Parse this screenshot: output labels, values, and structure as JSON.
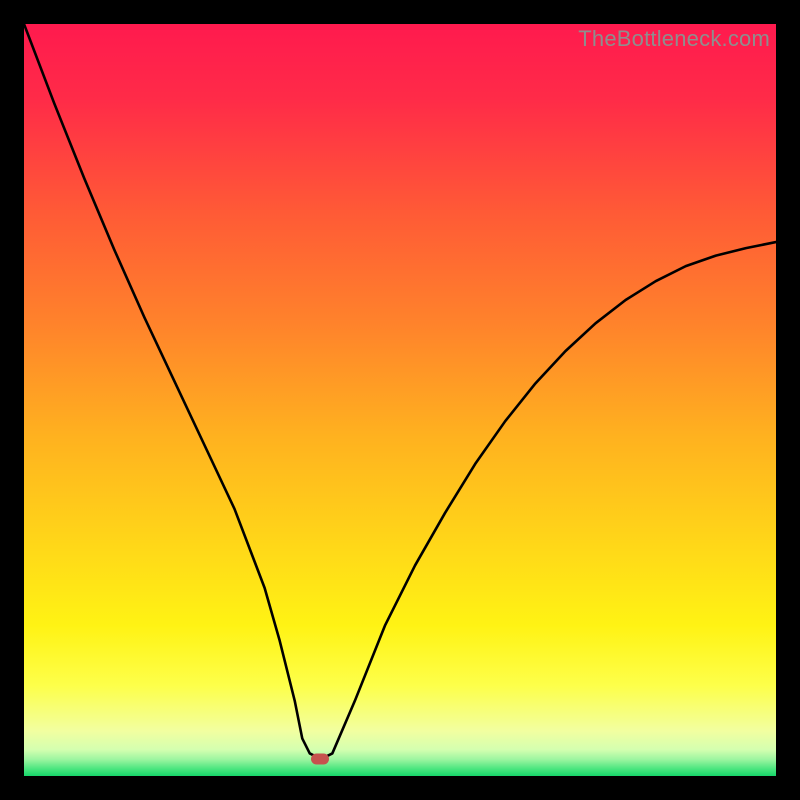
{
  "watermark": "TheBottleneck.com",
  "chart_data": {
    "type": "line",
    "title": "",
    "xlabel": "",
    "ylabel": "",
    "xlim": [
      0,
      100
    ],
    "ylim": [
      0,
      100
    ],
    "x": [
      0,
      4,
      8,
      12,
      16,
      20,
      24,
      28,
      32,
      34,
      36,
      37,
      38,
      39,
      40,
      41,
      44,
      48,
      52,
      56,
      60,
      64,
      68,
      72,
      76,
      80,
      84,
      88,
      92,
      96,
      100
    ],
    "y": [
      100,
      89.5,
      79.5,
      70,
      61,
      52.5,
      44,
      35.5,
      25,
      18,
      10,
      5,
      3,
      2.5,
      2.5,
      3,
      10,
      20,
      28,
      35,
      41.5,
      47.2,
      52.2,
      56.5,
      60.2,
      63.3,
      65.8,
      67.8,
      69.2,
      70.2,
      71
    ],
    "marker": {
      "x": 39.3,
      "y": 2.3
    },
    "gradient_stops": [
      {
        "offset": 0.0,
        "color": "#ff1a4e"
      },
      {
        "offset": 0.1,
        "color": "#ff2b48"
      },
      {
        "offset": 0.25,
        "color": "#ff5a36"
      },
      {
        "offset": 0.4,
        "color": "#ff832b"
      },
      {
        "offset": 0.55,
        "color": "#ffb21f"
      },
      {
        "offset": 0.7,
        "color": "#ffd918"
      },
      {
        "offset": 0.8,
        "color": "#fff314"
      },
      {
        "offset": 0.88,
        "color": "#fdff4a"
      },
      {
        "offset": 0.94,
        "color": "#f2ffa0"
      },
      {
        "offset": 0.965,
        "color": "#d4ffb0"
      },
      {
        "offset": 0.978,
        "color": "#9cf5a0"
      },
      {
        "offset": 0.99,
        "color": "#4ee680"
      },
      {
        "offset": 1.0,
        "color": "#16d66a"
      }
    ]
  }
}
